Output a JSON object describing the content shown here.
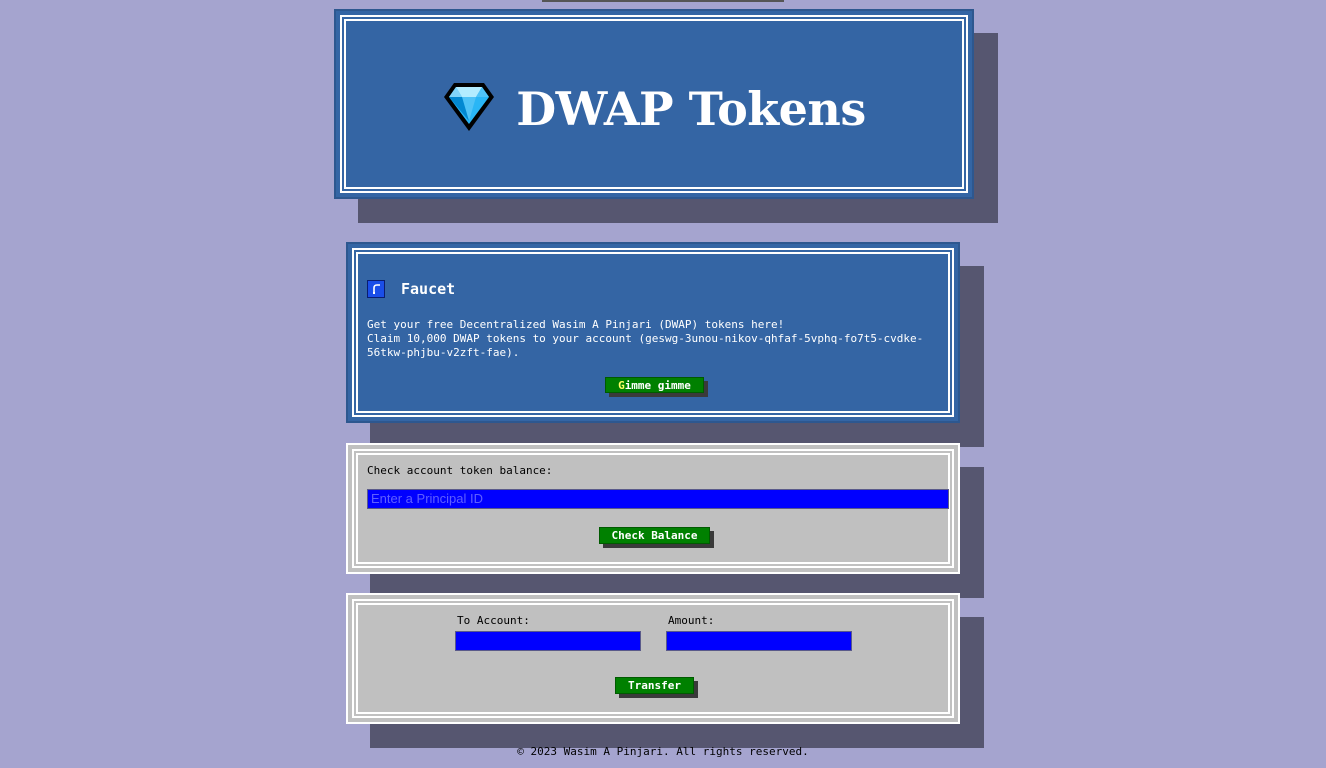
{
  "header": {
    "title": "DWAP Tokens",
    "logo_icon": "diamond-icon"
  },
  "faucet": {
    "title": "Faucet",
    "icon": "faucet-icon",
    "line1": "Get your free Decentralized Wasim A Pinjari (DWAP) tokens here!",
    "line2": "Claim 10,000 DWAP tokens to your account (geswg-3unou-nikov-qhfaf-5vphq-fo7t5-cvdke-56tkw-phjbu-v2zft-fae).",
    "button_first": "G",
    "button_rest": "imme gimme"
  },
  "balance": {
    "label": "Check account token balance:",
    "placeholder": "Enter a Principal ID",
    "button": "Check Balance"
  },
  "transfer": {
    "to_label": "To Account:",
    "amount_label": "Amount:",
    "button": "Transfer"
  },
  "footer": {
    "text": "© 2023 Wasim A Pinjari. All rights reserved."
  },
  "colors": {
    "background": "#a5a4cf",
    "panel_blue": "#3465a4",
    "panel_grey": "#c0c0c0",
    "button_green": "#008000",
    "input_blue": "#0000ff"
  }
}
